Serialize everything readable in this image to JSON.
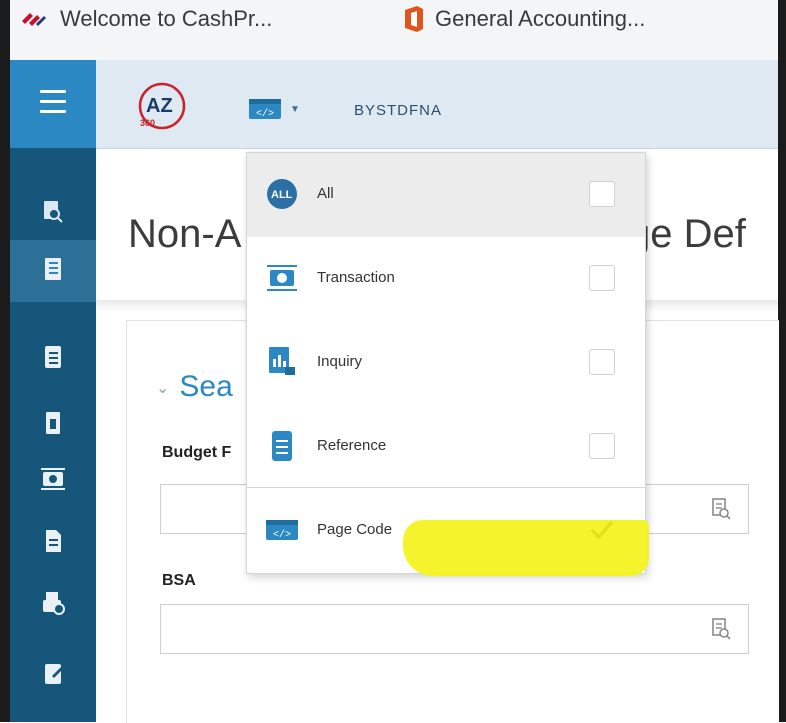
{
  "browser": {
    "bookmarks": [
      {
        "label": "Welcome to CashPr...",
        "icon": "flag-icon"
      },
      {
        "label": "General Accounting...",
        "icon": "office-icon"
      }
    ]
  },
  "header": {
    "environment": "BYSTDFNA",
    "logo": "az360-logo",
    "page_code_icon": "page-code-icon"
  },
  "page": {
    "title_left": "Non-A",
    "title_right": "ge Def",
    "search_section": "Sea",
    "fields": [
      {
        "label": "Budget F",
        "value": ""
      },
      {
        "label": "BSA",
        "value": ""
      }
    ]
  },
  "dropdown": {
    "items": [
      {
        "label": "All",
        "icon": "all-icon",
        "checked": false
      },
      {
        "label": "Transaction",
        "icon": "transaction-icon",
        "checked": false
      },
      {
        "label": "Inquiry",
        "icon": "inquiry-icon",
        "checked": false
      },
      {
        "label": "Reference",
        "icon": "reference-icon",
        "checked": false
      },
      {
        "label": "Page Code",
        "icon": "page-code-icon",
        "checked": true
      }
    ]
  },
  "colors": {
    "nav": "#16567a",
    "nav_top": "#2b88c2",
    "header": "#dfe9f2",
    "accent": "#2b88c2",
    "highlight": "#f4f31a"
  }
}
